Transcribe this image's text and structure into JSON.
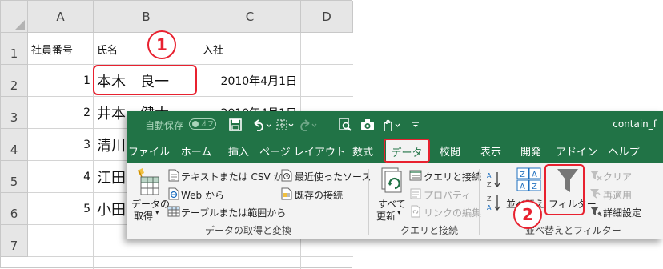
{
  "sheet": {
    "columns": [
      "A",
      "B",
      "C",
      "D"
    ],
    "rows": [
      "1",
      "2",
      "3",
      "4",
      "5",
      "6",
      "7"
    ],
    "header_row": {
      "a": "社員番号",
      "b": "氏名",
      "c": "入社"
    },
    "data_rows": [
      {
        "num": "1",
        "name": "本木　良一",
        "date": "2010年4月1日"
      },
      {
        "num": "2",
        "name": "井本　健太",
        "date": "2010年4月1日"
      },
      {
        "num": "3",
        "name": "清川"
      },
      {
        "num": "4",
        "name": "江田"
      },
      {
        "num": "5",
        "name": "小田"
      }
    ]
  },
  "callouts": {
    "one": "1",
    "two": "2"
  },
  "titlebar": {
    "autosave": "自動保存",
    "toggle": "オフ",
    "doc_name": "contain_f"
  },
  "tabs": [
    "ファイル",
    "ホーム",
    "挿入",
    "ページ レイアウト",
    "数式",
    "データ",
    "校閲",
    "表示",
    "開発",
    "アドイン",
    "ヘルプ"
  ],
  "active_tab": "データ",
  "groups": {
    "get_data": {
      "label": "データの取得と変換",
      "get_data_btn": [
        "データの",
        "取得"
      ],
      "from_text_csv": "テキストまたは CSV から",
      "from_web": "Web から",
      "from_table": "テーブルまたは範囲から",
      "recent_sources": "最近使ったソース",
      "existing_connections": "既存の接続"
    },
    "queries": {
      "label": "クエリと接続",
      "refresh_all": [
        "すべて",
        "更新"
      ],
      "queries_connections": "クエリと接続",
      "properties": "プロパティ",
      "edit_links": "リンクの編集"
    },
    "sort_filter": {
      "label": "並べ替えとフィルター",
      "sort": "並べ替え",
      "filter": "フィルター",
      "clear": "クリア",
      "reapply": "再適用",
      "advanced": "詳細設定"
    }
  },
  "colors": {
    "accent_green": "#217346",
    "highlight_red": "#e8212f"
  }
}
